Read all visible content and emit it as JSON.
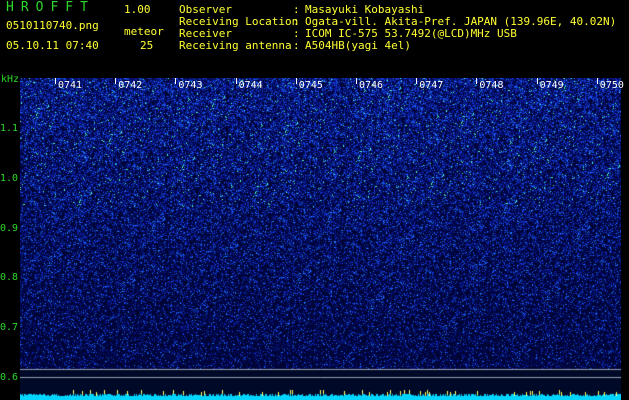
{
  "app": {
    "title": "HROFFT",
    "version": "1.00",
    "filename": "0510110740.png",
    "datetime": "05.10.11 07:40",
    "meteor_label": "meteor",
    "meteor_count": "25"
  },
  "info": [
    {
      "label": "Observer",
      "value": "Masayuki Kobayashi"
    },
    {
      "label": "Receiving Location",
      "value": "Ogata-vill. Akita-Pref. JAPAN (139.96E, 40.02N)"
    },
    {
      "label": "Receiver",
      "value": "ICOM IC-575 53.7492(@LCD)MHz USB"
    },
    {
      "label": "Receiving antenna",
      "value": "A504HB(yagi 4el)"
    }
  ],
  "spectrogram": {
    "y_unit": "kHz",
    "y_ticks": [
      "1.1",
      "1.0",
      "0.9",
      "0.8",
      "0.7",
      "0.6"
    ],
    "x_ticks": [
      "0741",
      "0742",
      "0743",
      "0744",
      "0745",
      "0746",
      "0747",
      "0748",
      "0749",
      "0750"
    ],
    "colors": {
      "background": "#000000",
      "noise_low": "#0a1a8a",
      "noise_mid": "#1e5aff",
      "noise_high": "#33ffcc",
      "marker": "#ffffff",
      "baseline": "#00e5ff"
    }
  }
}
